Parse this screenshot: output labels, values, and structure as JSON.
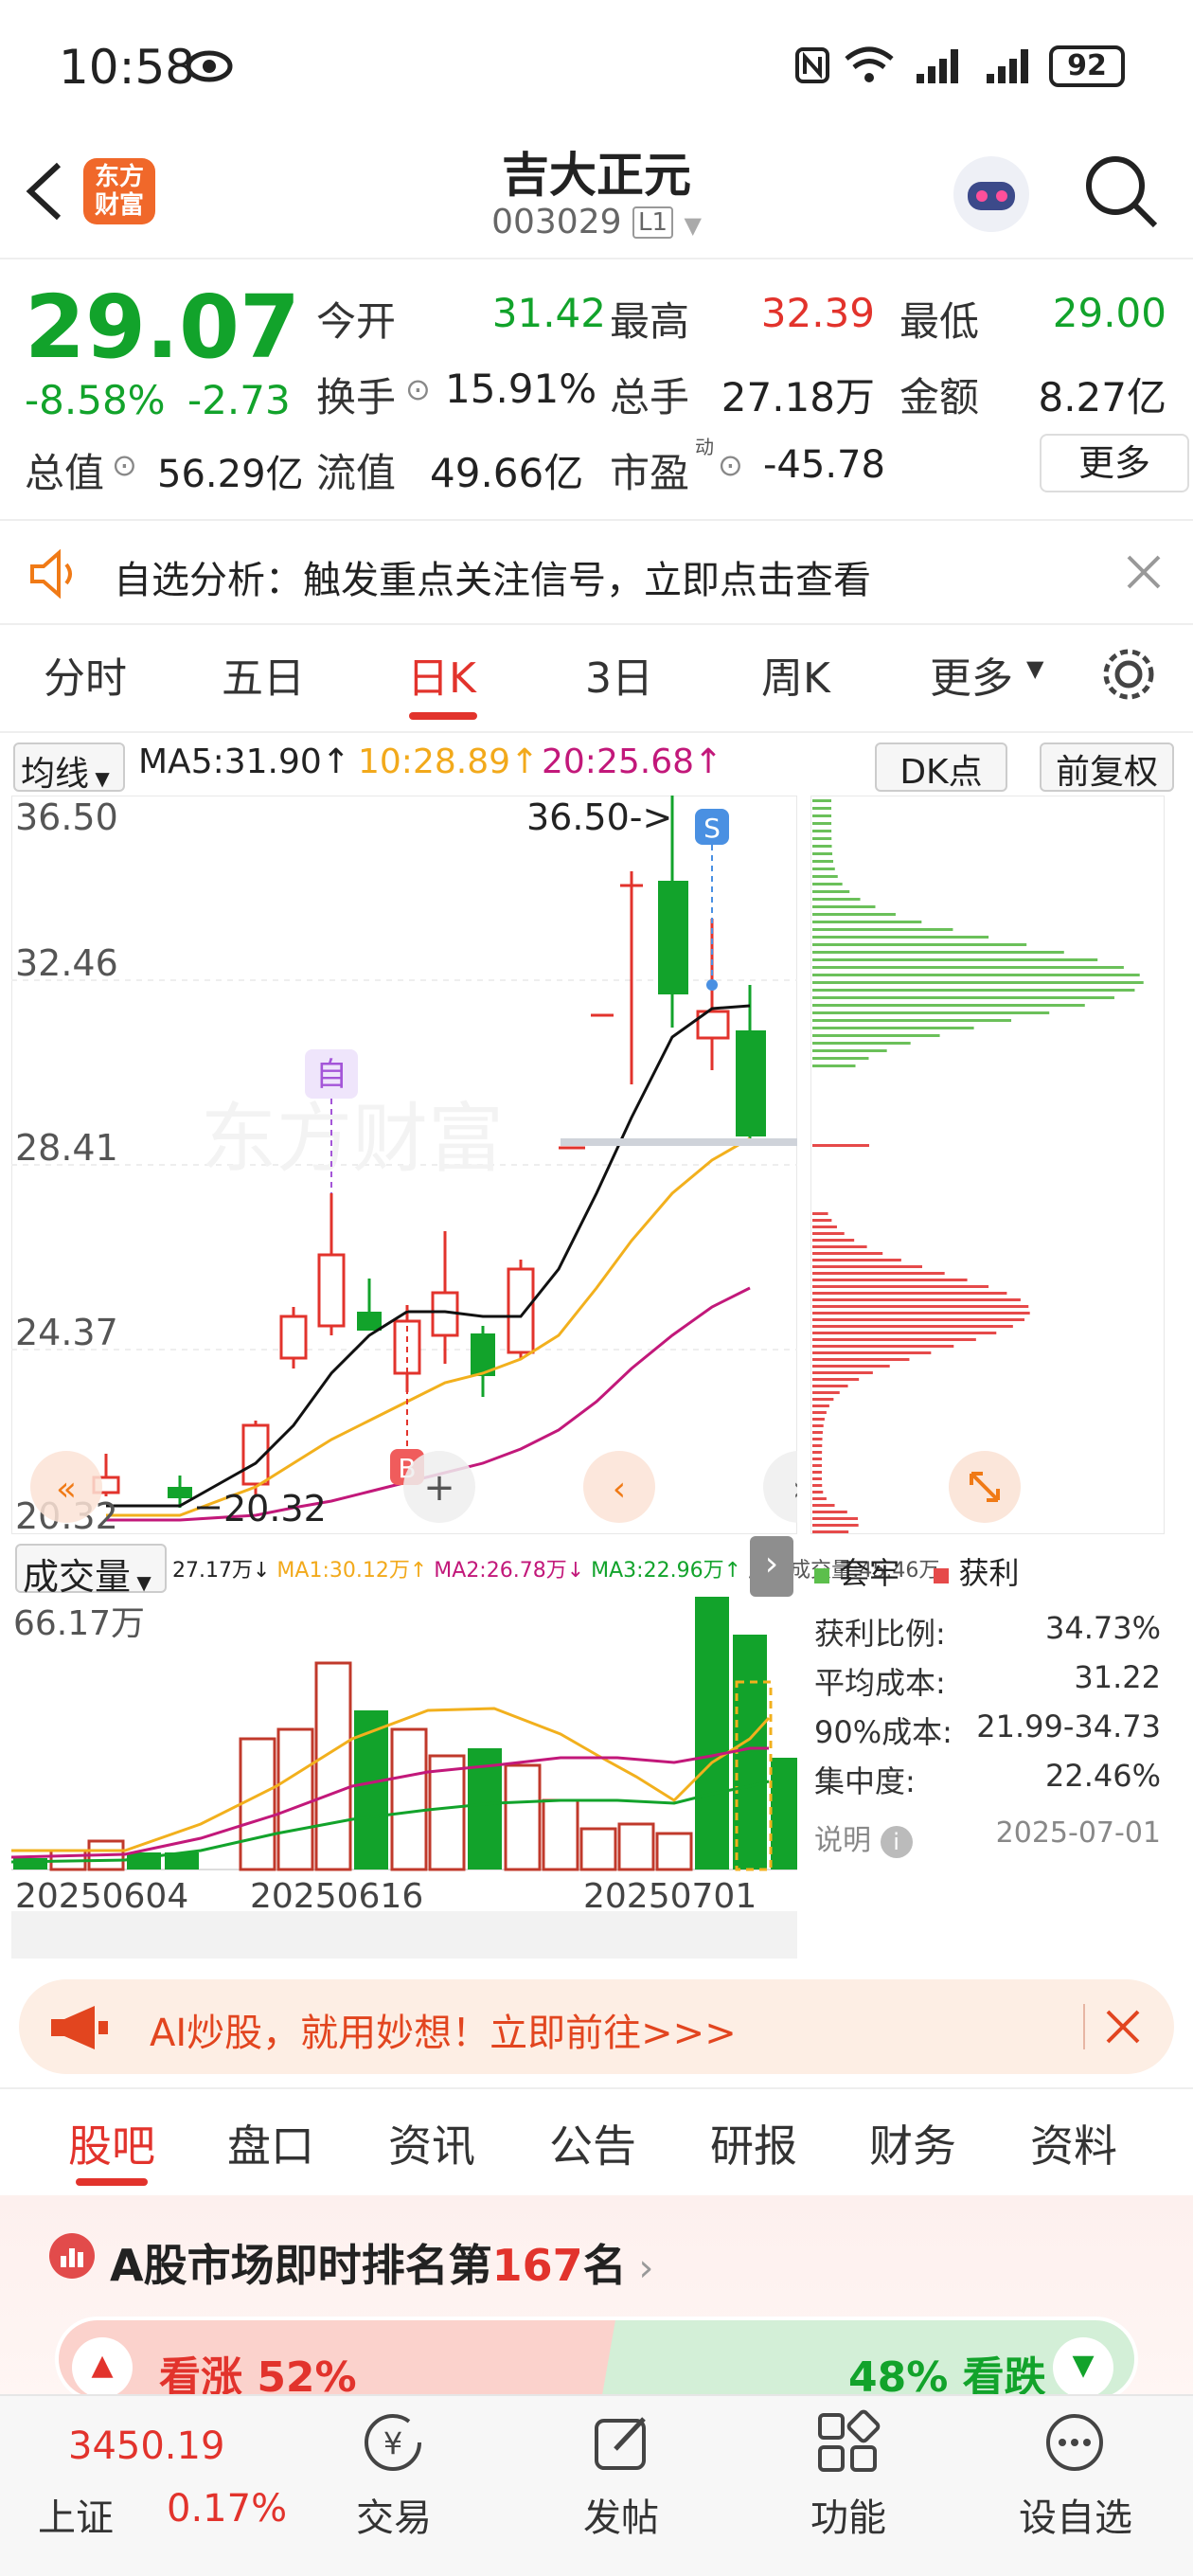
{
  "status": {
    "time": "10:58",
    "battery": "92"
  },
  "header": {
    "logo": "东方财富",
    "name": "吉大正元",
    "code": "003029",
    "tag": "L1"
  },
  "quote": {
    "price": "29.07",
    "change_pct": "-8.58%",
    "change": "-2.73",
    "open_label": "今开",
    "open": "31.42",
    "high_label": "最高",
    "high": "32.39",
    "low_label": "最低",
    "low": "29.00",
    "turnover_label": "换手",
    "turnover": "15.91%",
    "volume_label": "总手",
    "volume": "27.18万",
    "amount_label": "金额",
    "amount": "8.27亿",
    "mcap_label": "总值",
    "mcap": "56.29亿",
    "float_label": "流值",
    "float": "49.66亿",
    "pe_label": "市盈",
    "pe_sup": "动",
    "pe": "-45.78",
    "more": "更多"
  },
  "notice": {
    "text": "自选分析：触发重点关注信号，立即点击查看"
  },
  "ktabs": [
    "分时",
    "五日",
    "日K",
    "3日",
    "周K",
    "更多"
  ],
  "indicators": {
    "select": "均线",
    "ma5": "MA5:31.90↑",
    "ma10": "10:28.89↑",
    "ma20": "20:25.68↑",
    "dk": "DK点",
    "adjust": "前复权"
  },
  "kchart": {
    "ymax": "36.50",
    "y2": "32.46",
    "y3": "28.41",
    "y4": "24.37",
    "ymin": "20.32",
    "max_marker": "36.50->",
    "min_marker": "20.32",
    "buy": "B",
    "sell": "S",
    "self": "自"
  },
  "volume": {
    "select": "成交量",
    "max": "66.17万",
    "legend": [
      "27.17万↓",
      "MA1:30.12万↑",
      "MA2:26.78万↓",
      "MA3:22.96万↑",
      "虚拟成交量:45.46万"
    ],
    "dates": [
      "20250604",
      "20250616",
      "20250701"
    ]
  },
  "chip": {
    "legend_trap": "套牢",
    "legend_profit": "获利",
    "rows": [
      {
        "label": "获利比例:",
        "value": "34.73%"
      },
      {
        "label": "平均成本:",
        "value": "31.22"
      },
      {
        "label": "90%成本:",
        "value": "21.99-34.73"
      },
      {
        "label": "集中度:",
        "value": "22.46%"
      }
    ],
    "note": "说明",
    "date": "2025-07-01"
  },
  "ai_banner": "AI炒股，就用妙想！立即前往>>>",
  "btabs": [
    "股吧",
    "盘口",
    "资讯",
    "公告",
    "研报",
    "财务",
    "资料"
  ],
  "rank": {
    "prefix": "A股市场即时排名第",
    "num": "167",
    "suffix": "名"
  },
  "sentiment": {
    "up": "看涨 52%",
    "down": "48% 看跌"
  },
  "nav": {
    "index_value": "3450.19",
    "index_name": "上证",
    "index_pct": "0.17%",
    "items": [
      "交易",
      "发帖",
      "功能",
      "设自选"
    ]
  },
  "colors": {
    "up": "#e2332c",
    "down": "#12a32b",
    "accent": "#f07a16"
  }
}
